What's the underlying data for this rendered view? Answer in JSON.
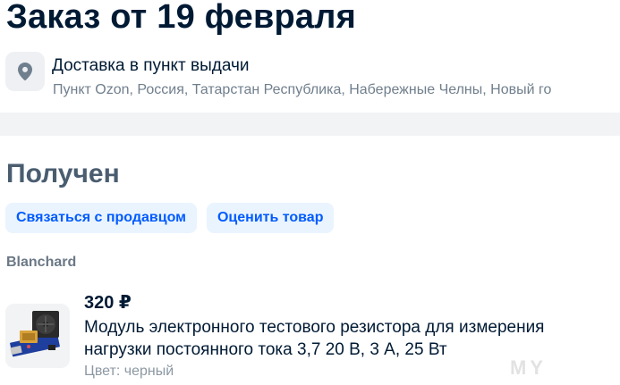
{
  "order": {
    "title": "Заказ от 19 февраля"
  },
  "delivery": {
    "icon": "location-pin-icon",
    "title": "Доставка в пункт выдачи",
    "address": "Пункт Ozon, Россия, Татарстан Республика, Набережные Челны, Новый го"
  },
  "status": {
    "title": "Получен"
  },
  "actions": {
    "contact_seller": "Связаться с продавцом",
    "rate_product": "Оценить товар"
  },
  "seller": {
    "name": "Blanchard"
  },
  "product": {
    "price": "320 ₽",
    "name": "Модуль электронного тестового резистора для измерения\nнагрузки постоянного тока 3,7 20 В, 3 А, 25 Вт",
    "color_label": "Цвет:",
    "color_value": "черный",
    "image_icon": "electronic-load-module-image"
  },
  "watermark": {
    "text": "MY"
  },
  "colors": {
    "accent": "#005bff",
    "accent_bg": "#eaf4ff",
    "text_primary": "#001a34",
    "text_secondary": "#707f8d",
    "status_text": "#4a5d70",
    "divider": "#f2f3f5"
  }
}
